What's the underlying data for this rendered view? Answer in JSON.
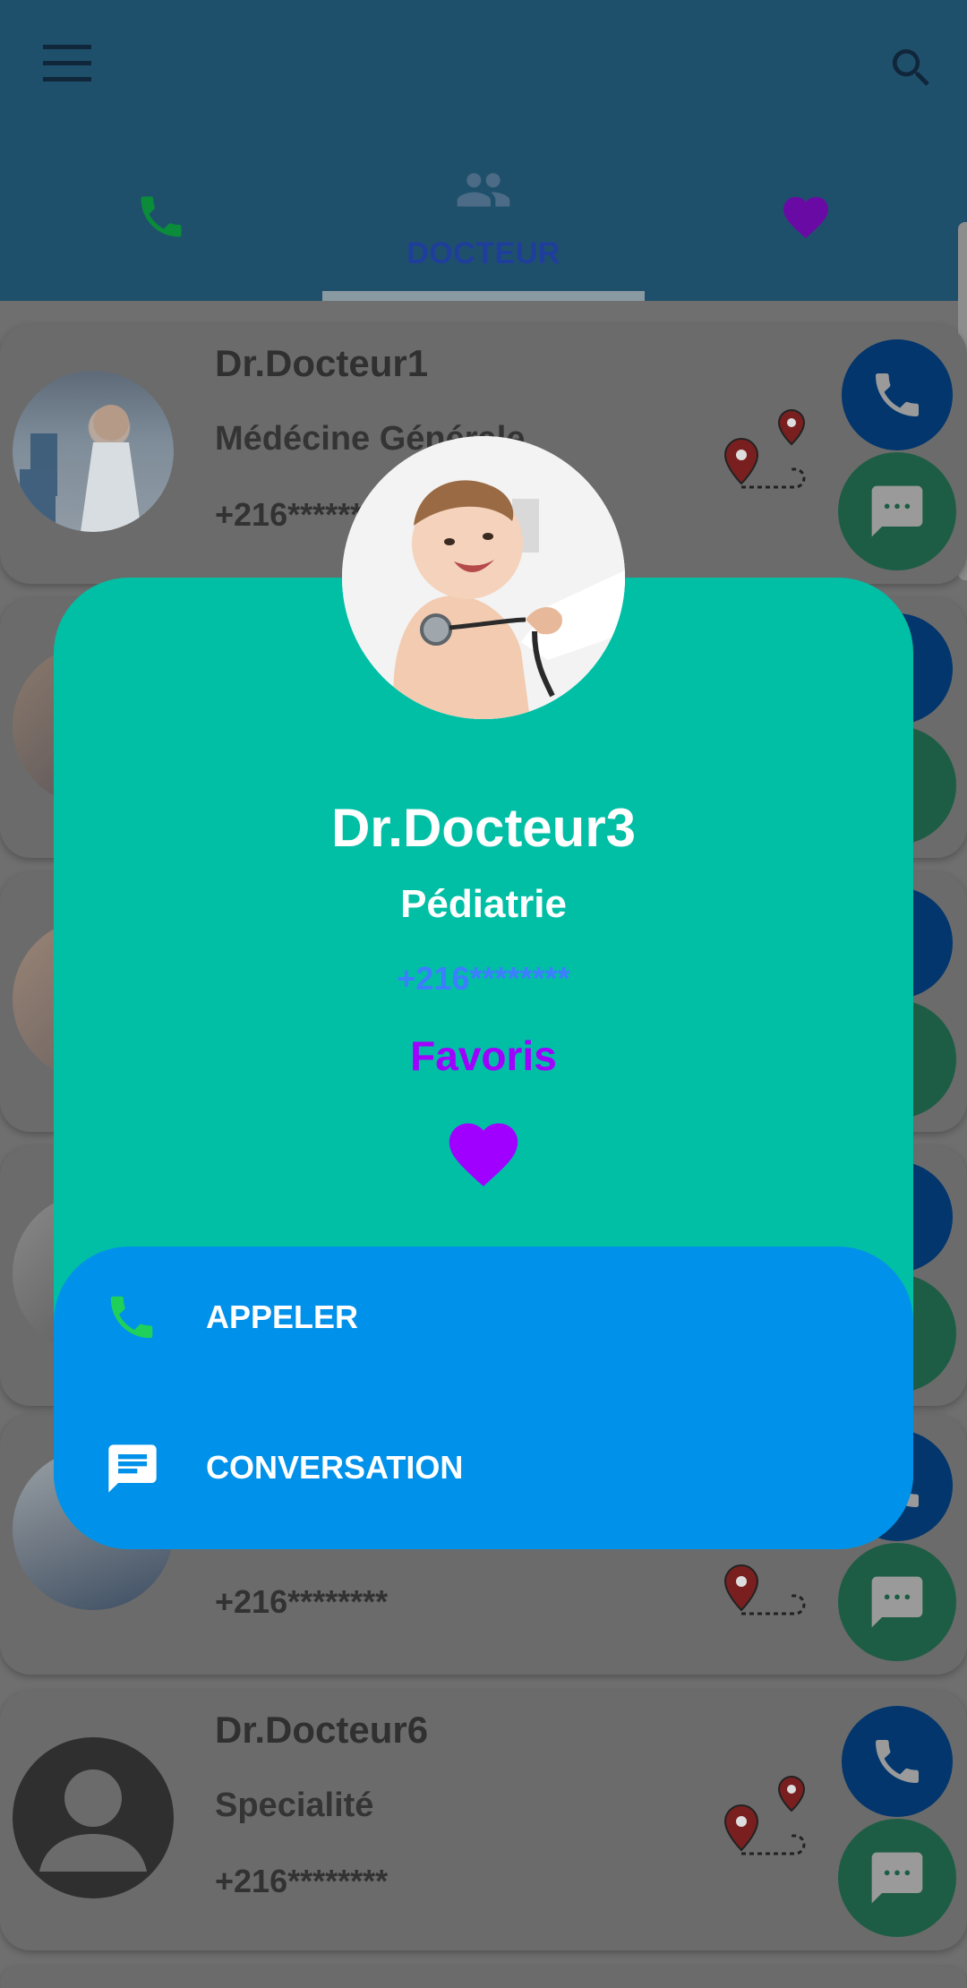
{
  "appbar": {
    "tabs": [
      {
        "label": "",
        "icon": "phone-icon",
        "color": "#0a8c3a"
      },
      {
        "label": "DOCTEUR",
        "icon": "people-icon",
        "color": "#1f3e9c"
      },
      {
        "label": "",
        "icon": "heart-icon",
        "color": "#6a0aa5"
      }
    ],
    "menu_icon": "menu-icon",
    "search_icon": "search-icon"
  },
  "doctors": [
    {
      "name": "Dr.Docteur1",
      "specialty": "Médécine Générale",
      "phone": "+216********",
      "avatar": "doctor-photo"
    },
    {
      "name": "",
      "specialty": "",
      "phone": "",
      "avatar": "doctor-photo"
    },
    {
      "name": "",
      "specialty": "",
      "phone": "",
      "avatar": "doctor-photo"
    },
    {
      "name": "",
      "specialty": "",
      "phone": "",
      "avatar": "doctor-photo"
    },
    {
      "name": "",
      "specialty": "",
      "phone": "+216********",
      "avatar": "doctor-photo"
    },
    {
      "name": "Dr.Docteur6",
      "specialty": "Specialité",
      "phone": "+216********",
      "avatar": "person-placeholder-icon"
    }
  ],
  "dialog": {
    "name": "Dr.Docteur3",
    "specialty": "Pédiatrie",
    "phone": "+216********",
    "favorite_label": "Favoris",
    "favorite_color": "#a000ff",
    "background": "#01bfa5",
    "actions": [
      {
        "label": "APPELER",
        "icon": "phone-icon"
      },
      {
        "label": "CONVERSATION",
        "icon": "chat-icon"
      }
    ],
    "actions_background": "#0091ea"
  }
}
